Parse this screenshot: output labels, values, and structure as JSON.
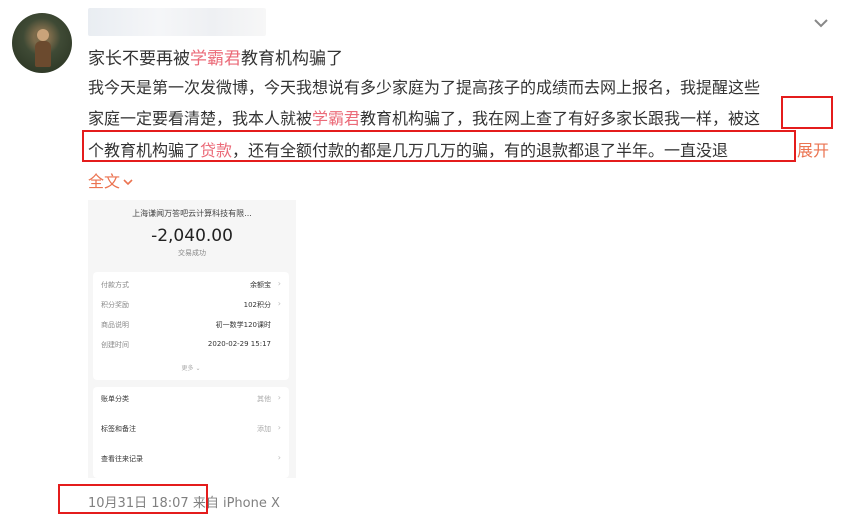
{
  "post": {
    "title_a": "家长不要再被",
    "title_b": "学霸君",
    "title_c": "教育机构骗了",
    "line1": "我今天是第一次发微博，今天我想说有多少家庭为了提高孩子的成绩而去网上报名，我提醒这些",
    "line2_a": "家庭一定要看清楚，我本人就被",
    "line2_b": "学霸君",
    "line2_c": "教育机构骗了，我在网上查了有好多家长跟我一样，",
    "line2_d": "被这",
    "line3_a": "个教育机构骗了",
    "line3_b": "贷款",
    "line3_c": "，还有全额付款的都是几万几万的骗，有的退款都退了半年。一直没退",
    "expand_label": "展开",
    "fulltext_label": "全文",
    "time": "10月31日 18:07",
    "source": "来自 iPhone X"
  },
  "receipt": {
    "merchant": "上海谦闻万答吧云计算科技有限...",
    "amount": "-2,040.00",
    "status": "交易成功",
    "details": [
      {
        "key": "付款方式",
        "value": "余额宝"
      },
      {
        "key": "积分奖励",
        "value": "102积分"
      },
      {
        "key": "商品说明",
        "value": "初一数学120课时"
      },
      {
        "key": "创建时间",
        "value": "2020-02-29 15:17"
      }
    ],
    "more_label": "更多",
    "actions": [
      {
        "key": "账单分类",
        "value": "其他"
      },
      {
        "key": "标签和备注",
        "value": "添加"
      },
      {
        "key": "查看往来记录",
        "value": ""
      }
    ]
  },
  "colors": {
    "accent": "#eb7350",
    "keyword": "#eb6b79",
    "highlight": "#e41c1c"
  },
  "icons": {
    "menu": "chevron-down-icon",
    "fulltext": "chevron-down-icon"
  }
}
